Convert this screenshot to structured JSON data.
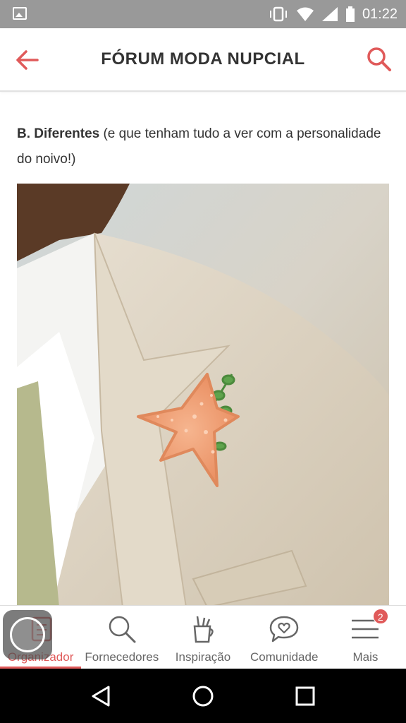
{
  "status_bar": {
    "time": "01:22",
    "icons": [
      "image-notification-icon",
      "vibrate-icon",
      "wifi-icon",
      "signal-icon",
      "battery-icon"
    ]
  },
  "app_bar": {
    "title": "FÓRUM MODA NUPCIAL",
    "back_icon": "arrow-left-icon",
    "search_icon": "search-icon",
    "accent_color": "#e05a5a"
  },
  "post": {
    "bold": "B. Diferentes",
    "text": " (e que tenham tudo a ver com a personalidade do noivo!)",
    "image_icon": "starfish-boutonniere-photo"
  },
  "bottom_nav": {
    "items": [
      {
        "label": "Organizador",
        "icon": "checklist-icon",
        "active": true
      },
      {
        "label": "Fornecedores",
        "icon": "search-icon",
        "active": false
      },
      {
        "label": "Inspiração",
        "icon": "pencil-cup-icon",
        "active": false
      },
      {
        "label": "Comunidade",
        "icon": "heart-chat-icon",
        "active": false
      },
      {
        "label": "Mais",
        "icon": "menu-icon",
        "active": false,
        "badge": "2"
      }
    ]
  },
  "android_nav": {
    "back": "back-triangle-icon",
    "home": "home-circle-icon",
    "recents": "recents-square-icon"
  }
}
